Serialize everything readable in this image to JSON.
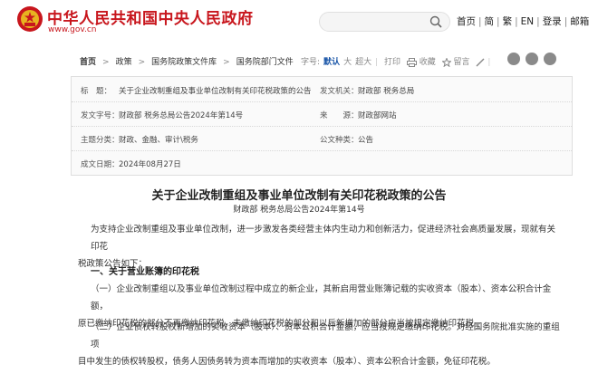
{
  "header": {
    "site_title": "中华人民共和国中央人民政府",
    "site_url": "www.gov.cn",
    "top_links": [
      "首页",
      "简",
      "繁",
      "EN",
      "登录",
      "邮箱"
    ],
    "colors": {
      "brand": "#c8161d"
    }
  },
  "breadcrumb": [
    "首页",
    "政策",
    "国务院政策文件库",
    "国务院部门文件"
  ],
  "toolbar": {
    "font_size_label": "字号:",
    "font_default": "默认",
    "font_large": "大",
    "font_xlarge": "超大",
    "print": "打印",
    "favorite": "收藏",
    "comment": "留言"
  },
  "info": {
    "title_label": "标　题：",
    "title_value": "关于企业改制重组及事业单位改制有关印花税政策的公告",
    "issuer_label": "发文机关：",
    "issuer_value": "财政部  税务总局",
    "doc_no_label": "发文字号：",
    "doc_no_value": "财政部 税务总局公告2024年第14号",
    "source_label": "来　　源：",
    "source_value": "财政部网站",
    "category_label": "主题分类：",
    "category_value": "财政、金融、审计\\税务",
    "type_label": "公文种类：",
    "type_value": "公告",
    "date_label": "成文日期：",
    "date_value": "2024年08月27日"
  },
  "doc": {
    "title": "关于企业改制重组及事业单位改制有关印花税政策的公告",
    "subtitle": "财政部  税务总局公告2024年第14号",
    "intro_line1": "为支持企业改制重组及事业单位改制，进一步激发各类经营主体内生动力和创新活力，促进经济社会高质量发展，现就有关印花",
    "intro_line2": "税政策公告如下：",
    "section1": "一、关于营业账簿的印花税",
    "p1_line1": "（一）企业改制重组以及事业单位改制过程中成立的新企业，其新启用营业账簿记载的实收资本（股本）、资本公积合计金额，",
    "p1_line2": "原已缴纳印花税的部分不再缴纳印花税，未缴纳印花税的部分和以后新增加的部分应当按规定缴纳印花税。",
    "p2_line1": "（二）企业债权转股权新增加的实收资本（股本）、资本公积合计金额，应当按规定缴纳印花税。对经国务院批准实施的重组项",
    "p2_line2": "目中发生的债权转股权，债务人因债务转为资本而增加的实收资本（股本）、资本公积合计金额，免征印花税。"
  }
}
